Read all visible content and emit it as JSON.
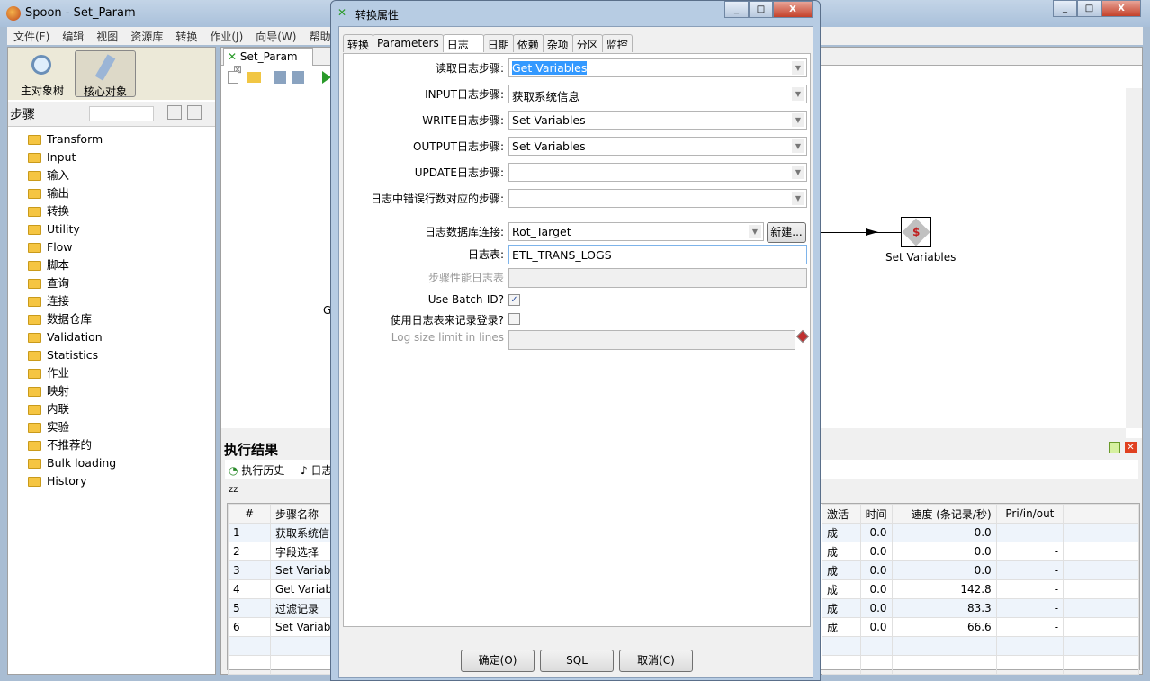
{
  "app": {
    "title": "Spoon - Set_Param",
    "window_buttons": [
      "_",
      "□",
      "X"
    ]
  },
  "menu": [
    "文件(F)",
    "编辑",
    "视图",
    "资源库",
    "转换",
    "作业(J)",
    "向导(W)",
    "帮助"
  ],
  "left": {
    "btn_tree": "主对象树",
    "btn_core": "核心对象",
    "steps_label": "步骤",
    "categories": [
      "Transform",
      "Input",
      "输入",
      "输出",
      "转换",
      "Utility",
      "Flow",
      "脚本",
      "查询",
      "连接",
      "数据仓库",
      "Validation",
      "Statistics",
      "作业",
      "映射",
      "内联",
      "实验",
      "不推荐的",
      "Bulk loading",
      "History"
    ]
  },
  "editor": {
    "tab": "Set_Param",
    "canvas_partial": "G",
    "step_label": "Set Variables"
  },
  "results": {
    "title": "执行结果",
    "tabs": [
      "执行历史",
      "日志"
    ],
    "columns_left": [
      "#",
      "步骤名称"
    ],
    "columns_right": [
      "激活",
      "时间",
      "速度 (条记录/秒)",
      "Pri/in/out"
    ],
    "rows": [
      {
        "n": "1",
        "name": "获取系统信",
        "status": "成",
        "time": "0.0",
        "speed": "0.0",
        "pio": "-"
      },
      {
        "n": "2",
        "name": "字段选择",
        "status": "成",
        "time": "0.0",
        "speed": "0.0",
        "pio": "-"
      },
      {
        "n": "3",
        "name": "Set Variab",
        "status": "成",
        "time": "0.0",
        "speed": "0.0",
        "pio": "-"
      },
      {
        "n": "4",
        "name": "Get Variab",
        "status": "成",
        "time": "0.0",
        "speed": "142.8",
        "pio": "-"
      },
      {
        "n": "5",
        "name": "过滤记录",
        "status": "成",
        "time": "0.0",
        "speed": "83.3",
        "pio": "-"
      },
      {
        "n": "6",
        "name": "Set Variab",
        "status": "成",
        "time": "0.0",
        "speed": "66.6",
        "pio": "-"
      }
    ]
  },
  "dialog": {
    "title": "转换属性",
    "tabs": [
      "转换",
      "Parameters",
      "日志",
      "日期",
      "依赖",
      "杂项",
      "分区",
      "监控"
    ],
    "active_tab": "日志",
    "fields": {
      "read_label": "读取日志步骤:",
      "read_value": "Get Variables",
      "input_label": "INPUT日志步骤:",
      "input_value": "获取系统信息",
      "write_label": "WRITE日志步骤:",
      "write_value": "Set Variables",
      "output_label": "OUTPUT日志步骤:",
      "output_value": "Set Variables",
      "update_label": "UPDATE日志步骤:",
      "update_value": "",
      "error_label": "日志中错误行数对应的步骤:",
      "error_value": "",
      "conn_label": "日志数据库连接:",
      "conn_value": "Rot_Target",
      "new_button": "新建...",
      "table_label": "日志表:",
      "table_value": "ETL_TRANS_LOGS",
      "perf_label": "步骤性能日志表",
      "perf_value": "",
      "batch_label": "Use Batch-ID?",
      "batch_checked": true,
      "uselog_label": "使用日志表来记录登录?",
      "uselog_checked": false,
      "logsize_label": "Log size limit in lines",
      "logsize_value": ""
    },
    "ok": "确定(O)",
    "sql": "SQL",
    "cancel": "取消(C)"
  }
}
